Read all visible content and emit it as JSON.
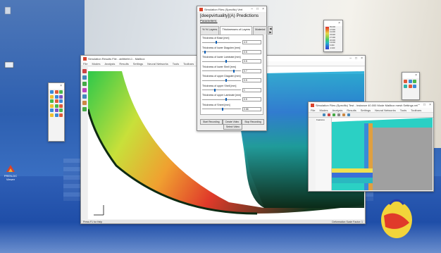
{
  "desktop": {
    "icons": [
      {
        "name": "desktop-icon-top",
        "label": ""
      },
      {
        "name": "desktop-icon-mid",
        "label": ""
      },
      {
        "name": "desktop-icon-app",
        "label": "PREN-DC Viewer"
      }
    ]
  },
  "main_window": {
    "title": "Simulation Results File - abfrtiefel-1 - Mailbox",
    "menu": [
      "File",
      "Modes",
      "Analysis",
      "Results",
      "Settings",
      "Neural Networks",
      "Tools",
      "Toolbars"
    ],
    "status_left": "Press F1 for Help",
    "status_right": "Deformation Scale Factor: 1"
  },
  "predictions_dialog": {
    "title": "Simulation Files (Specific) Vert",
    "heading": "[deepvirtuality](A) Predictions",
    "parameters_label": "Parameters:",
    "tabs": [
      "% % Layers",
      "Thicknesses of Layers",
      "Material"
    ],
    "tab_arrows": "◀ ▶",
    "params": [
      {
        "label": "Thickness of Base [mm]",
        "value": "4.0",
        "level": 0.35
      },
      {
        "label": "Thickness of lower Diagolen [mm]",
        "value": "0.5",
        "level": 0.05
      },
      {
        "label": "Thickness of lower Laminate [mm]",
        "value": "0.5",
        "level": 0.6
      },
      {
        "label": "Thickness of lower Shell [mm]",
        "value": "0.7",
        "level": 0.8
      },
      {
        "label": "Thickness of upper Diagolen [mm]",
        "value": "0.5",
        "level": 0.6
      },
      {
        "label": "Thickness of upper Shell [mm]",
        "value": "1",
        "level": 0.3
      },
      {
        "label": "Thickness of upper Laminate [mm]",
        "value": "0.5",
        "level": 0.6
      },
      {
        "label": "Thickness of Sheet [mm]",
        "value": "0.66",
        "level": 0.5
      }
    ],
    "buttons": {
      "start": "Start Recording",
      "create": "Create Video",
      "stop": "Stop Recording",
      "select": "Select Video"
    }
  },
  "legend": {
    "labels": [
      "55.000",
      "47.500",
      "41.000",
      "33.900",
      "27.300",
      "20.600",
      "13.000",
      "6.300",
      "-0.400"
    ]
  },
  "inner_window": {
    "title": "Simulation Files (Specific) Test - Instance 40.000 Mode Mailbox mesh Settings retrieve",
    "menu": [
      "File",
      "Modes",
      "Analysis",
      "Results",
      "Settings",
      "Neural Networks",
      "Tools",
      "Toolbars"
    ],
    "tree_label": "Features"
  },
  "colors": {
    "accent": "#0b5fb8",
    "app_icon": "#d9432b"
  }
}
